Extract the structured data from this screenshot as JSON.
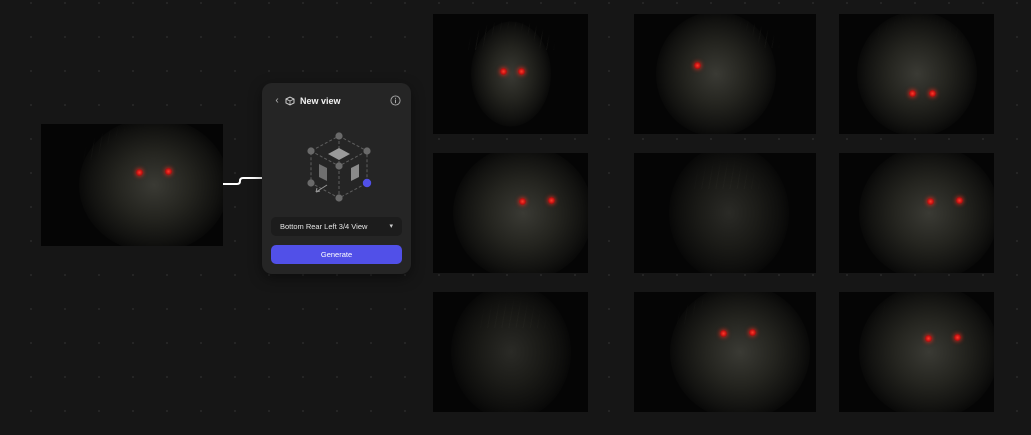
{
  "panel": {
    "title": "New view",
    "view_select": {
      "value": "Bottom Rear Left 3/4 View"
    },
    "generate_label": "Generate",
    "accent_color": "#5150e8"
  },
  "icons": {
    "back": "chevron-left-icon",
    "view": "rotate-view-icon",
    "info": "info-icon",
    "select": "chevron-down-icon"
  },
  "grid": {
    "rows": 3,
    "columns": 3,
    "items": [
      {
        "view": "front"
      },
      {
        "view": "side-left"
      },
      {
        "view": "rear-top"
      },
      {
        "view": "three-quarter-left"
      },
      {
        "view": "rear-left"
      },
      {
        "view": "three-quarter-left"
      },
      {
        "view": "rear"
      },
      {
        "view": "three-quarter-left"
      },
      {
        "view": "three-quarter-left"
      }
    ]
  }
}
